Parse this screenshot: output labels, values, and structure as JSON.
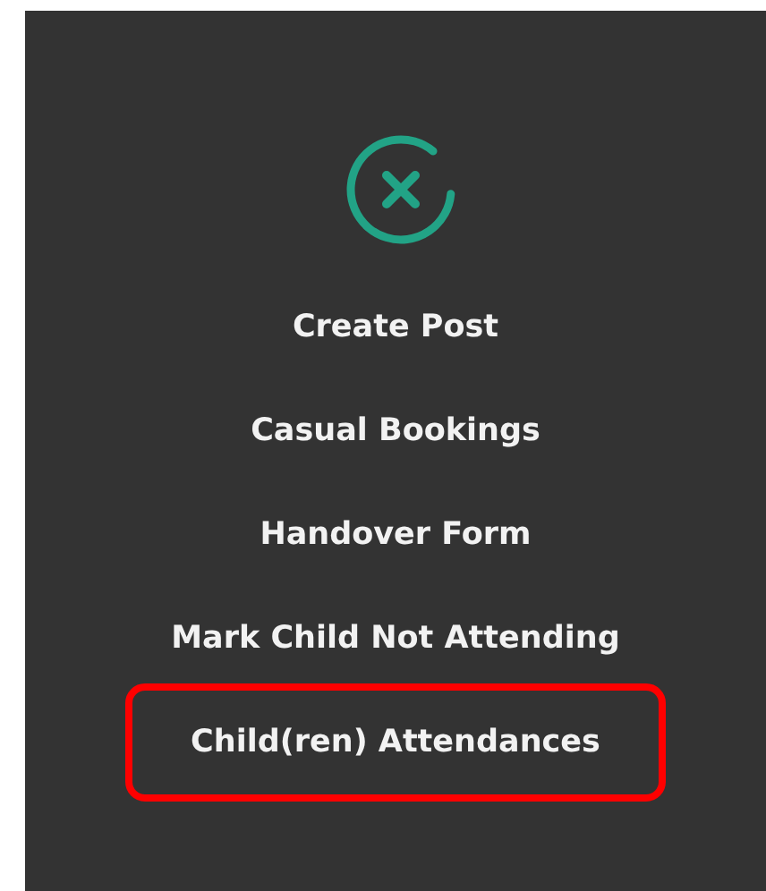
{
  "menu_items": [
    {
      "label": "Create Post",
      "highlighted": false
    },
    {
      "label": "Casual Bookings",
      "highlighted": false
    },
    {
      "label": "Handover Form",
      "highlighted": false
    },
    {
      "label": "Mark Child Not Attending",
      "highlighted": false
    },
    {
      "label": "Child(ren) Attendances",
      "highlighted": true
    }
  ]
}
